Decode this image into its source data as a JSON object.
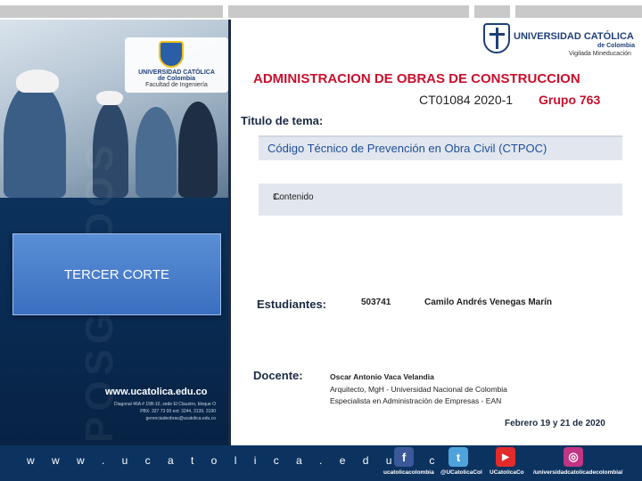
{
  "header": {
    "university_name": "UNIVERSIDAD CATÓLICA",
    "university_sub": "de Colombia",
    "vigilada": "Vigilada Mineducación"
  },
  "left_panel": {
    "logo_name": "UNIVERSIDAD CATÓLICA",
    "logo_sub": "de Colombia",
    "faculty": "Facultad de Ingeniería",
    "vertical_word": "POSGRADOS",
    "corte_label": "TERCER CORTE",
    "website": "www.ucatolica.edu.co",
    "address_lines": [
      "Diagonal 46A # 15B-10, sede El Claustro, bloque O",
      "PBX: 327 73 00 ext: 3244, 3139, 3190",
      "gerenciadeobras@ucatolica.edu.co"
    ]
  },
  "course": {
    "title": "ADMINISTRACION DE OBRAS DE CONSTRUCCION",
    "code": "CT01084 2020-1",
    "group": "Grupo 763"
  },
  "topic": {
    "label": "Titulo de tema:",
    "value": "Código Técnico de Prevención en Obra Civil (CTPOC)"
  },
  "content": {
    "number": "1.",
    "item": "Contenido"
  },
  "students": {
    "label": "Estudiantes:",
    "id": "503741",
    "name": "Camilo Andrés Venegas Marín"
  },
  "teacher": {
    "label": "Docente:",
    "name": "Oscar Antonio Vaca Velandia",
    "lines": [
      "Arquitecto, MgH - Universidad Nacional de Colombia",
      "Especialista en Administración de Empresas - EAN"
    ]
  },
  "date": "Febrero 19 y 21 de 2020",
  "footer": {
    "website": "w w w . u c a t o l i c a . e d u . c o",
    "social": [
      {
        "icon": "facebook-icon",
        "label": "ucatolicacolombia",
        "color": "#3b5998",
        "glyph": "f"
      },
      {
        "icon": "twitter-icon",
        "label": "@UCatolicaCol",
        "color": "#4fa3dd",
        "glyph": "t"
      },
      {
        "icon": "youtube-icon",
        "label": "UCatolicaCo",
        "color": "#e32b2b",
        "glyph": "▶"
      },
      {
        "icon": "instagram-icon",
        "label": "/universidadcatolicadecolombia/",
        "color": "#c13584",
        "glyph": "◎"
      }
    ]
  },
  "colors": {
    "accent_red": "#c8102e",
    "navy": "#1b2a44",
    "panel_blue": "#0f3d6b",
    "topic_blue": "#1f4e9a"
  }
}
